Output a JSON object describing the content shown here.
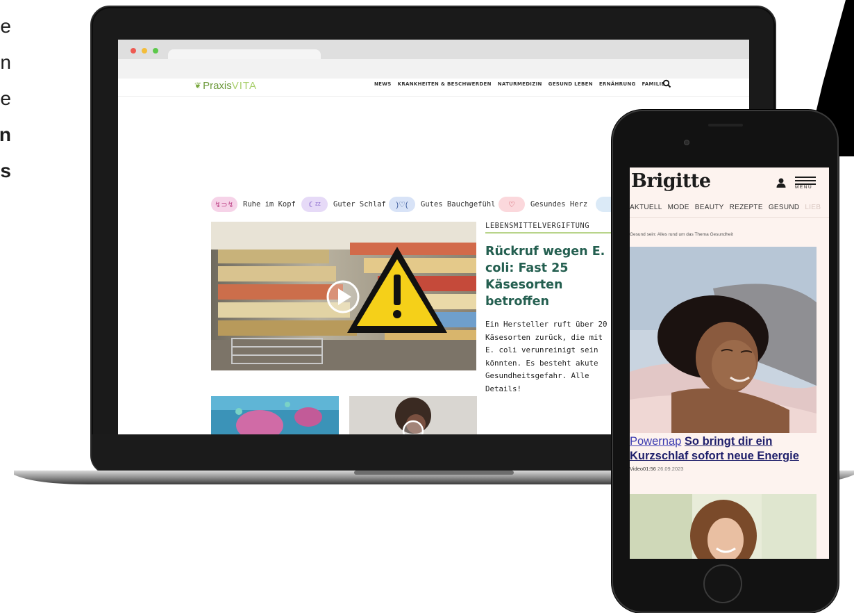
{
  "left_text": {
    "lines": [
      {
        "text": "e",
        "bold": false
      },
      {
        "text": "n",
        "bold": false
      },
      {
        "text": "e",
        "bold": false
      },
      {
        "text": "n",
        "bold": true
      },
      {
        "text": "s",
        "bold": true
      }
    ]
  },
  "laptop": {
    "site": {
      "logo_left": "Praxis",
      "logo_right": "VITA",
      "nav": [
        "NEWS",
        "KRANKHEITEN & BESCHWERDEN",
        "NATURMEDIZIN",
        "GESUND LEBEN",
        "ERNÄHRUNG",
        "FAMILIE"
      ],
      "search_icon": "search-icon"
    },
    "chips": [
      {
        "label": "Ruhe im Kopf",
        "icon": "ear-icon",
        "glyph": "↯⊃↯",
        "bg": "#f6d3e8",
        "fg": "#c0498a"
      },
      {
        "label": "Guter Schlaf",
        "icon": "moon-icon",
        "glyph": "☾ᶻᶻ",
        "bg": "#e6daf7",
        "fg": "#7a56c7"
      },
      {
        "label": "Gutes Bauchgefühl",
        "icon": "gut-icon",
        "glyph": ")♡(",
        "bg": "#d8e3f7",
        "fg": "#3d5c9c"
      },
      {
        "label": "Gesundes Herz",
        "icon": "heart-icon",
        "glyph": "♡",
        "bg": "#fbd8dc",
        "fg": "#c02a3c"
      }
    ],
    "hero": {
      "kicker": "LEBENSMITTELVERGIFTUNG",
      "headline": "Rückruf wegen E. coli: Fast 25 Käsesor­ten betroffen",
      "teaser": "Ein Hersteller ruft über 20 Käsesorten zurück, die mit E. coli verunreinigt sein könnten. Es besteht akute Gesundheitsgefahr. Alle Details!"
    }
  },
  "phone": {
    "brand": "Brigitte",
    "menu_label": "MENÜ",
    "nav": [
      "AKTUELL",
      "MODE",
      "BEAUTY",
      "REZEPTE",
      "GESUND",
      "LIEB"
    ],
    "breadcrumb": "Gesund sein: Alles rund um das Thema Gesundheit",
    "article": {
      "kicker": "Powernap",
      "title": "So bringt dir ein Kurzschlaf sofort neue Energie",
      "type": "Video",
      "duration": "01:56",
      "date": "26.09.2023"
    }
  },
  "colors": {
    "praxis_green": "#245f50",
    "brigitte_bg": "#fdf3ef",
    "brigitte_link": "#1f1f6b"
  }
}
